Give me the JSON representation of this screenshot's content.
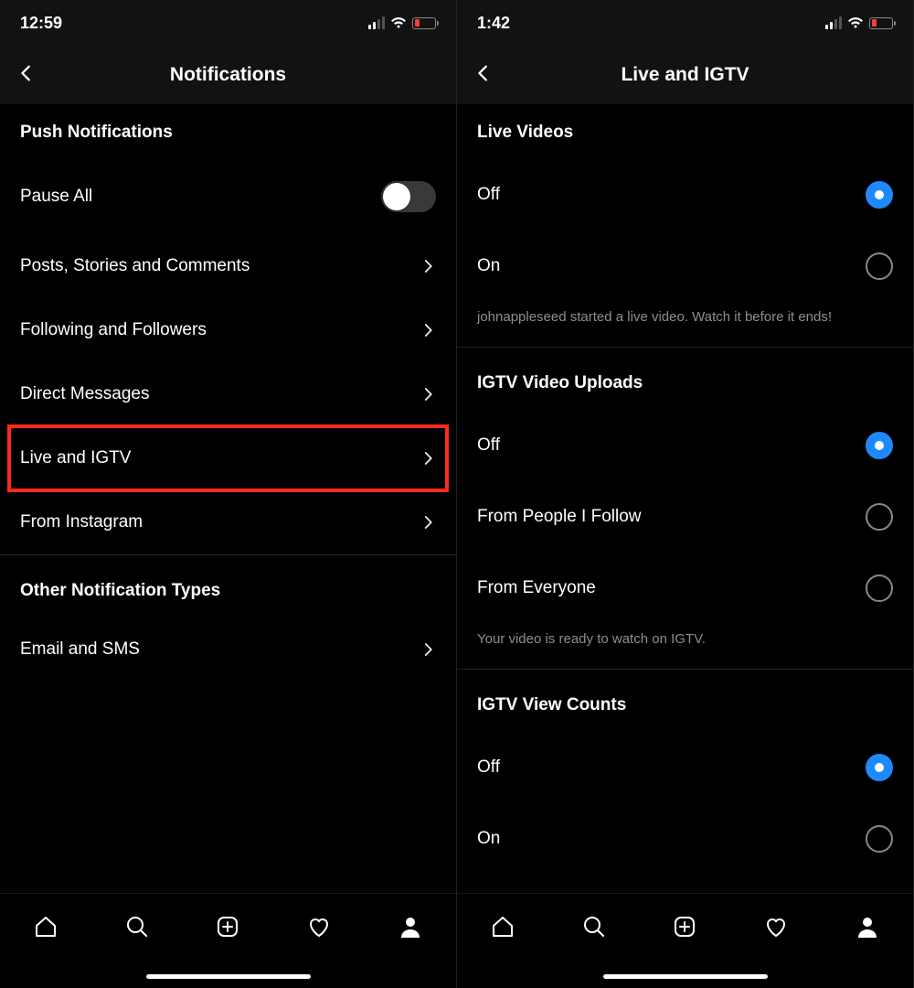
{
  "left": {
    "status": {
      "time": "12:59"
    },
    "header": {
      "title": "Notifications"
    },
    "section1_title": "Push Notifications",
    "pause_all": "Pause All",
    "items": {
      "posts": "Posts, Stories and Comments",
      "following": "Following and Followers",
      "dm": "Direct Messages",
      "live": "Live and IGTV",
      "from_ig": "From Instagram"
    },
    "section2_title": "Other Notification Types",
    "email_sms": "Email and SMS"
  },
  "right": {
    "status": {
      "time": "1:42"
    },
    "header": {
      "title": "Live and IGTV"
    },
    "live_videos": {
      "title": "Live Videos",
      "off": "Off",
      "on": "On",
      "hint": "johnappleseed started a live video. Watch it before it ends!"
    },
    "igtv_uploads": {
      "title": "IGTV Video Uploads",
      "off": "Off",
      "follow": "From People I Follow",
      "everyone": "From Everyone",
      "hint": "Your video is ready to watch on IGTV."
    },
    "igtv_views": {
      "title": "IGTV View Counts",
      "off": "Off",
      "on": "On"
    }
  }
}
